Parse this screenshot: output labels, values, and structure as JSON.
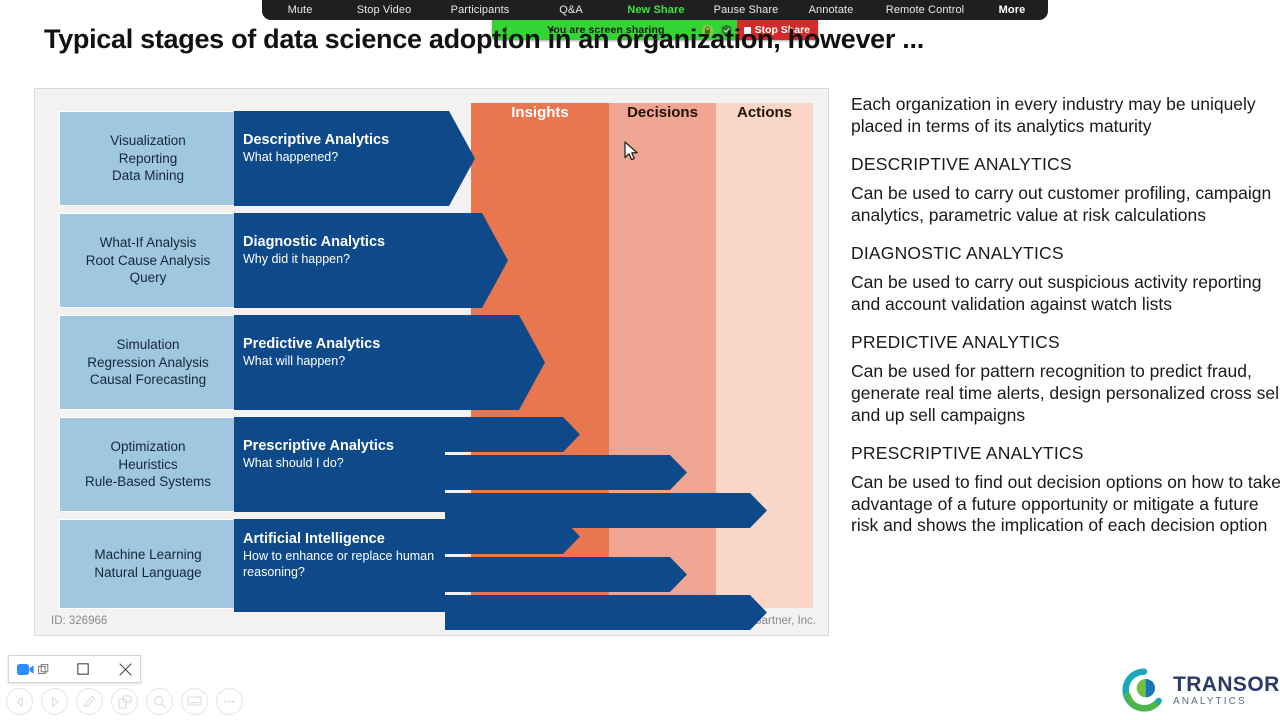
{
  "zoom_toolbar": {
    "items": [
      {
        "label": "Mute",
        "kind": "normal"
      },
      {
        "label": "Stop Video",
        "kind": "normal"
      },
      {
        "label": "Participants",
        "kind": "normal"
      },
      {
        "label": "Q&A",
        "kind": "normal"
      },
      {
        "label": "New Share",
        "kind": "newshare"
      },
      {
        "label": "Pause Share",
        "kind": "normal"
      },
      {
        "label": "Annotate",
        "kind": "normal"
      },
      {
        "label": "Remote Control",
        "kind": "normal"
      },
      {
        "label": "More",
        "kind": "more"
      }
    ]
  },
  "share_bar": {
    "status_text": "You are screen sharing",
    "stop_label": "Stop Share",
    "green_hex": "#35d435",
    "stop_hex": "#d32b2b"
  },
  "slide": {
    "title": "Typical stages of data science adoption in an organization, however ...",
    "diagram_id": "ID: 326966",
    "credit": "© 2018 Gartner, Inc.",
    "columns": [
      {
        "label": "Insights",
        "color": "#e8764e"
      },
      {
        "label": "Decisions",
        "color": "#f0a692"
      },
      {
        "label": "Actions",
        "color": "#f9d6c6"
      }
    ],
    "stages": [
      {
        "techniques": [
          "Visualization",
          "Reporting",
          "Data Mining"
        ],
        "title": "Descriptive Analytics",
        "question": "What happened?"
      },
      {
        "techniques": [
          "What-If Analysis",
          "Root Cause Analysis",
          "Query"
        ],
        "title": "Diagnostic Analytics",
        "question": "Why did it happen?"
      },
      {
        "techniques": [
          "Simulation",
          "Regression Analysis",
          "Causal Forecasting"
        ],
        "title": "Predictive Analytics",
        "question": "What will happen?"
      },
      {
        "techniques": [
          "Optimization",
          "Heuristics",
          "Rule-Based Systems"
        ],
        "title": "Prescriptive Analytics",
        "question": "What should I do?"
      },
      {
        "techniques": [
          "Machine Learning",
          "Natural Language"
        ],
        "title": "Artificial Intelligence",
        "question_line1": "How to enhance or replace human",
        "question_line2": "reasoning?"
      }
    ]
  },
  "right_panel": {
    "intro": "Each organization in every industry may be uniquely placed in terms of its analytics maturity",
    "sections": [
      {
        "heading": "DESCRIPTIVE ANALYTICS",
        "body": "Can be used to carry out customer profiling, campaign analytics, parametric value at risk calculations"
      },
      {
        "heading": "DIAGNOSTIC ANALYTICS",
        "body": "Can be used to carry out suspicious activity reporting and account validation against watch lists"
      },
      {
        "heading": "PREDICTIVE ANALYTICS",
        "body": "Can be used for pattern recognition to predict fraud, generate real time alerts, design personalized cross sell and up sell campaigns"
      },
      {
        "heading": "PRESCRIPTIVE ANALYTICS",
        "body": "Can be used to find out decision options on how to take advantage of a future opportunity or mitigate a future risk and shows the implication of each decision option"
      }
    ]
  },
  "logo": {
    "name": "TRANSORG",
    "sub": "ANALYTICS"
  },
  "mini_window": {
    "icons": [
      "video-camera-icon",
      "restore-window-icon",
      "close-icon"
    ]
  },
  "circle_toolbar": {
    "buttons": [
      "previous-slide-button",
      "next-slide-button",
      "pen-button",
      "copy-button",
      "zoom-button",
      "present-button",
      "more-button"
    ],
    "more_label": "•••"
  },
  "colors": {
    "blue_arrow": "#0e4a8a",
    "light_blue_box": "#9fc8e0",
    "panel_bg": "#f3f2f0"
  }
}
